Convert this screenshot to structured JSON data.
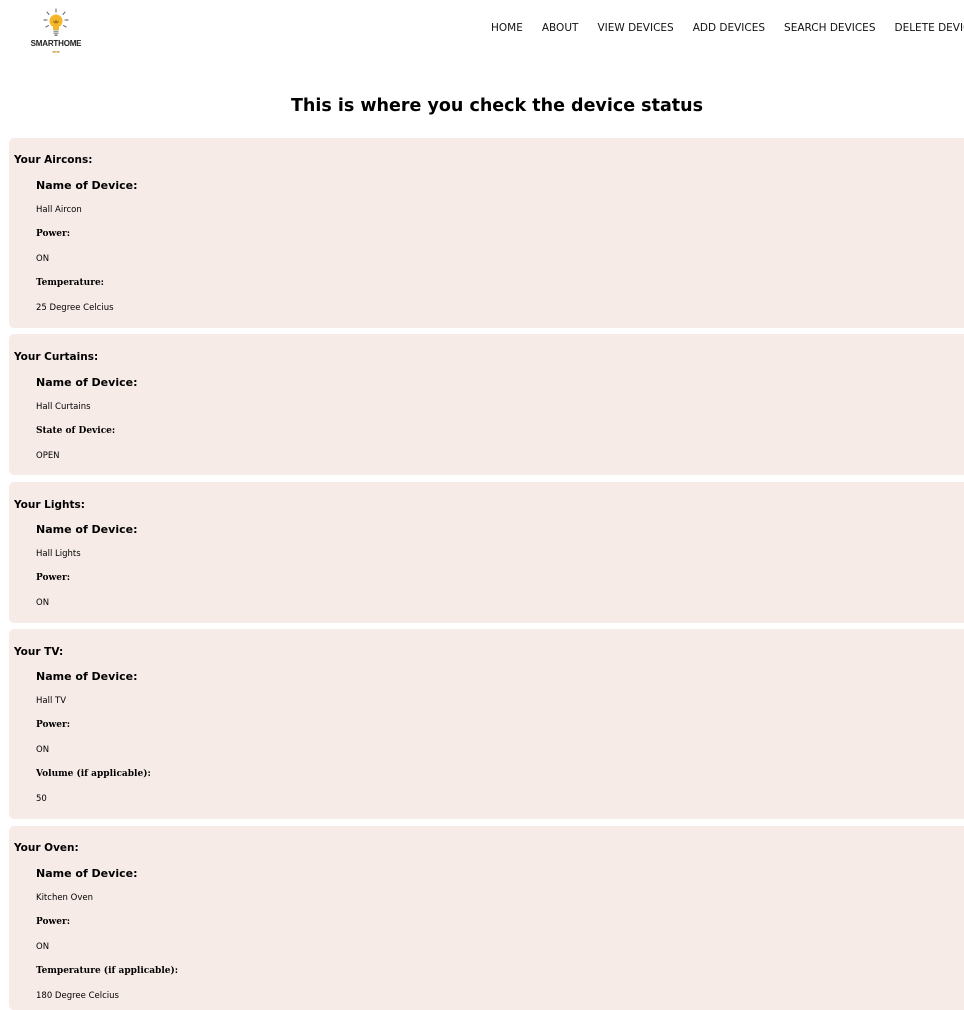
{
  "brand": {
    "name": "SMARTHOME",
    "logo_icon": "lightbulb-icon"
  },
  "nav": {
    "home": "HOME",
    "about": "ABOUT",
    "view_devices": "VIEW DEVICES",
    "add_devices": "ADD DEVICES",
    "search_devices": "SEARCH DEVICES",
    "delete_devices": "DELETE DEVICES"
  },
  "page_title": "This is where you check the device status",
  "colors": {
    "card_background": "#f7ebe8",
    "logo_bulb": "#f5b72a"
  },
  "aircons": {
    "heading": "Your Aircons:",
    "name_label": "Name of Device:",
    "name_value": "Hall Aircon",
    "power_label": "Power:",
    "power_value": "ON",
    "temp_label": "Temperature:",
    "temp_value": "25 Degree Celcius"
  },
  "curtains": {
    "heading": "Your Curtains:",
    "name_label": "Name of Device:",
    "name_value": "Hall Curtains",
    "state_label": "State of Device:",
    "state_value": "OPEN"
  },
  "lights": {
    "heading": "Your Lights:",
    "name_label": "Name of Device:",
    "name_value": "Hall Lights",
    "power_label": "Power:",
    "power_value": "ON"
  },
  "tv": {
    "heading": "Your TV:",
    "name_label": "Name of Device:",
    "name_value": "Hall TV",
    "power_label": "Power:",
    "power_value": "ON",
    "volume_label": "Volume (if applicable):",
    "volume_value": "50"
  },
  "oven": {
    "heading": "Your Oven:",
    "name_label": "Name of Device:",
    "name_value": "Kitchen Oven",
    "power_label": "Power:",
    "power_value": "ON",
    "temp_label": "Temperature (if applicable):",
    "temp_value": "180 Degree Celcius"
  }
}
